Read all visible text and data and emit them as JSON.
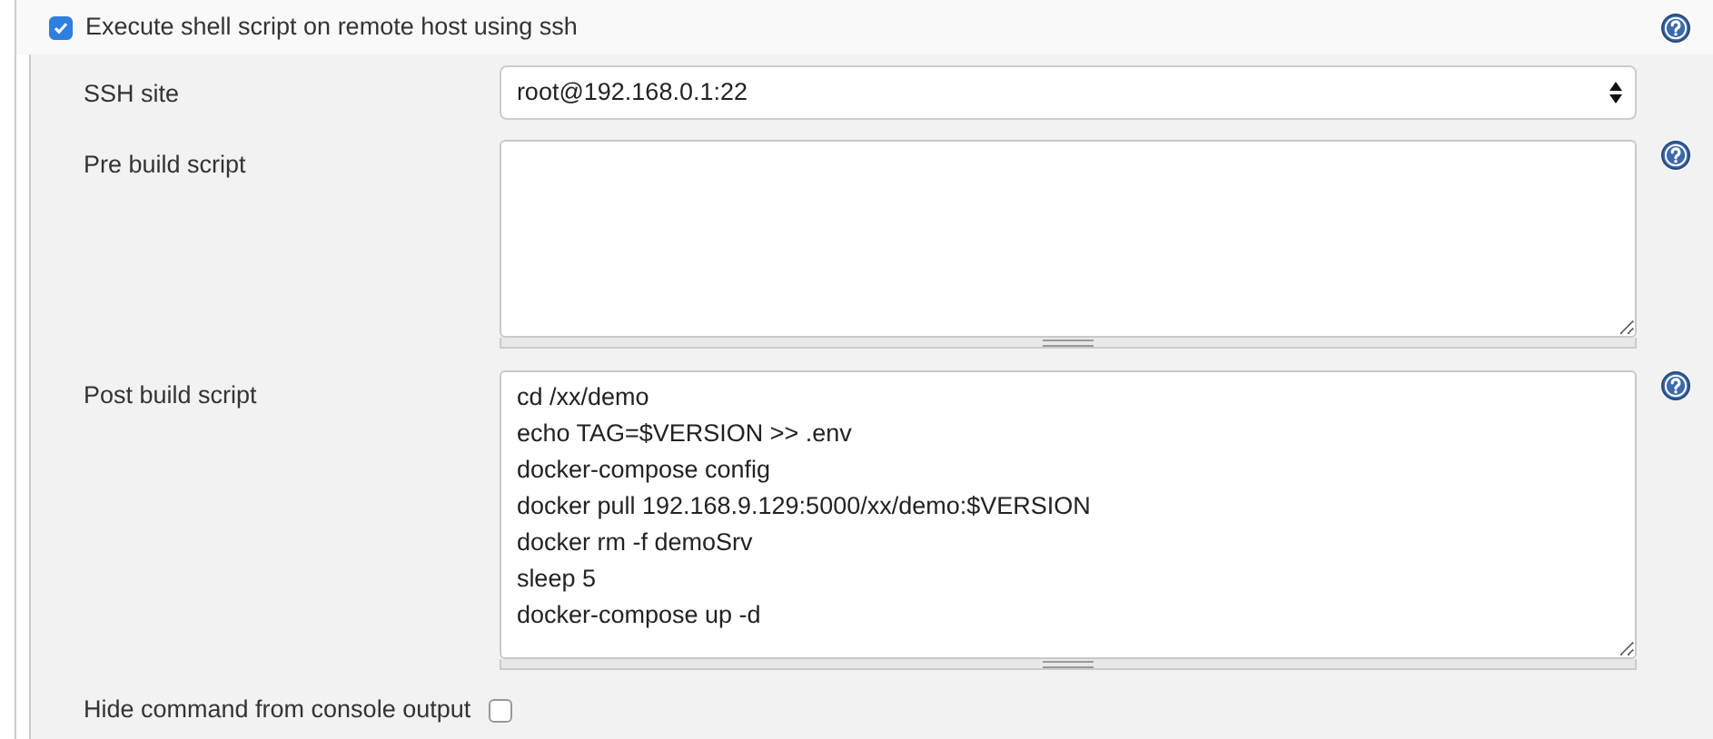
{
  "step": {
    "title": "Execute shell script on remote host using ssh",
    "checked": true
  },
  "fields": [
    {
      "kind": "select",
      "label": "SSH site",
      "value": "root@192.168.0.1:22",
      "help": false
    },
    {
      "kind": "textarea",
      "label": "Pre build script",
      "help": true
    },
    {
      "kind": "textarea",
      "label": "Post build script",
      "lines": [
        "cd /xx/demo",
        "echo TAG=$VERSION >> .env",
        "docker-compose config",
        "docker pull 192.168.9.129:5000/xx/demo:$VERSION",
        "docker rm -f demoSrv",
        "sleep 5",
        "docker-compose up -d"
      ],
      "help": true
    },
    {
      "kind": "checkbox",
      "label": "Hide command from console output",
      "checked": false,
      "help": false
    }
  ]
}
